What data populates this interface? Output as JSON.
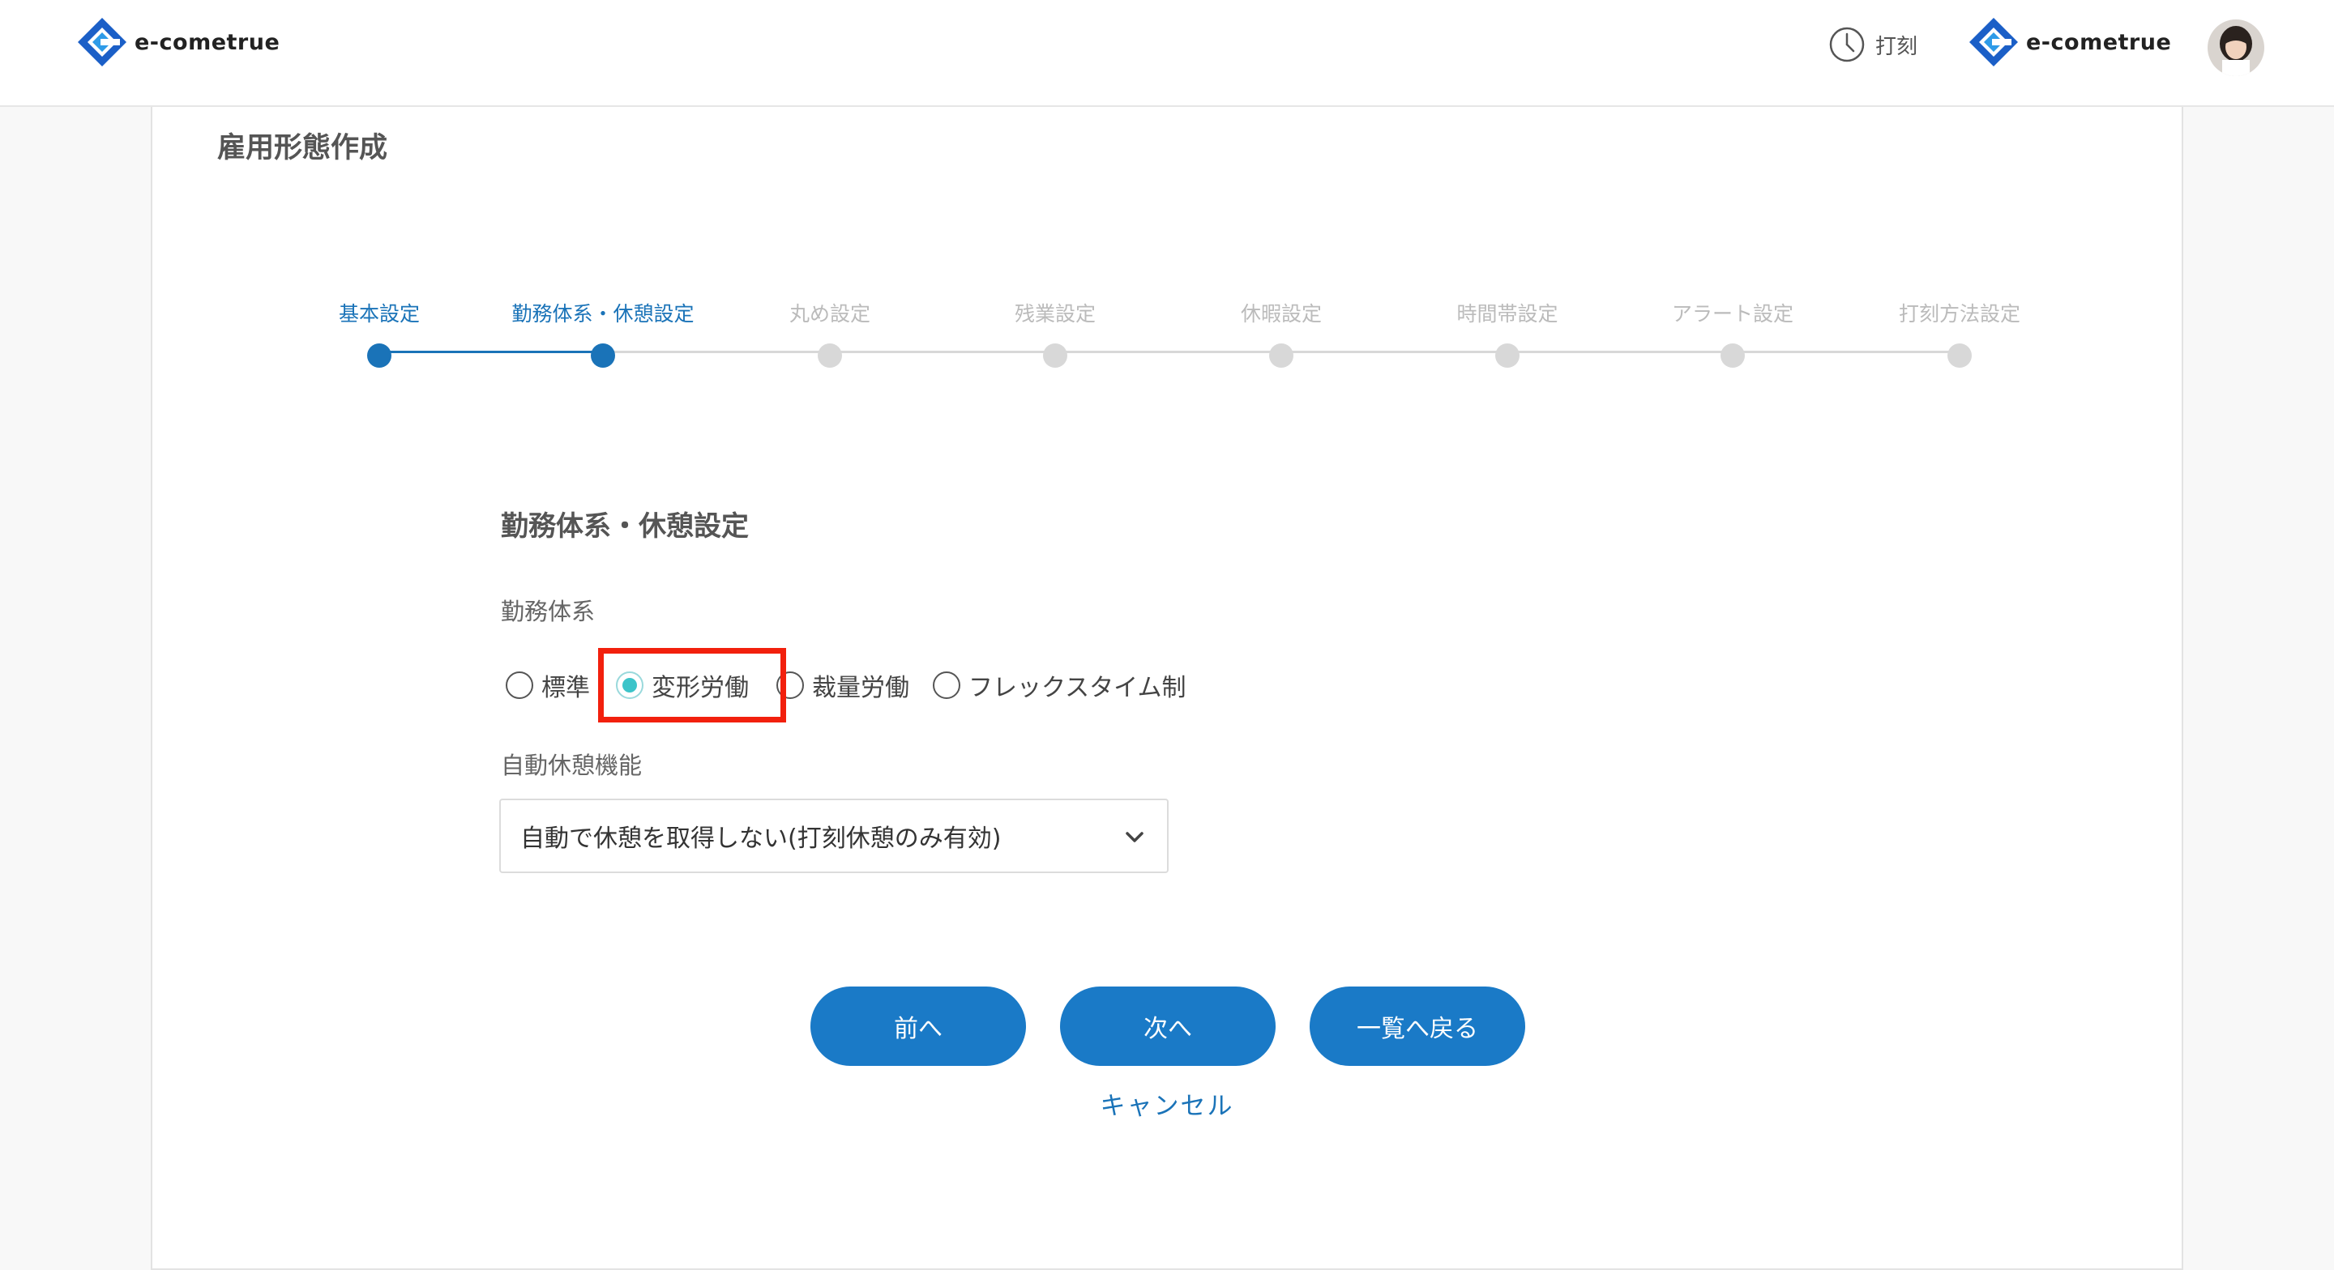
{
  "header": {
    "logo_text_left": "e-cometrue",
    "stamp_label": "打刻",
    "logo_text_right": "e-cometrue"
  },
  "page": {
    "title": "雇用形態作成"
  },
  "stepper": {
    "steps": [
      {
        "label": "基本設定",
        "state": "completed"
      },
      {
        "label": "勤務体系・休憩設定",
        "state": "current"
      },
      {
        "label": "丸め設定",
        "state": "pending"
      },
      {
        "label": "残業設定",
        "state": "pending"
      },
      {
        "label": "休暇設定",
        "state": "pending"
      },
      {
        "label": "時間帯設定",
        "state": "pending"
      },
      {
        "label": "アラート設定",
        "state": "pending"
      },
      {
        "label": "打刻方法設定",
        "state": "pending"
      }
    ]
  },
  "form": {
    "section_title": "勤務体系・休憩設定",
    "work_system": {
      "label": "勤務体系",
      "options": [
        "標準",
        "変形労働",
        "裁量労働",
        "フレックスタイム制"
      ],
      "selected": "変形労働"
    },
    "auto_break": {
      "label": "自動休憩機能",
      "selected": "自動で休憩を取得しない(打刻休憩のみ有効)"
    }
  },
  "actions": {
    "prev": "前へ",
    "next": "次へ",
    "back_to_list": "一覧へ戻る",
    "cancel": "キャンセル"
  },
  "colors": {
    "primary": "#1a7ac7",
    "step_active": "#1a73b8",
    "step_inactive": "#d8d8d8",
    "radio_checked": "#3cc4c9",
    "highlight": "#f2200d"
  },
  "icons": {
    "logo": "e-cometrue-logo-icon",
    "stamp": "clock-icon",
    "select": "chevron-down-icon"
  }
}
